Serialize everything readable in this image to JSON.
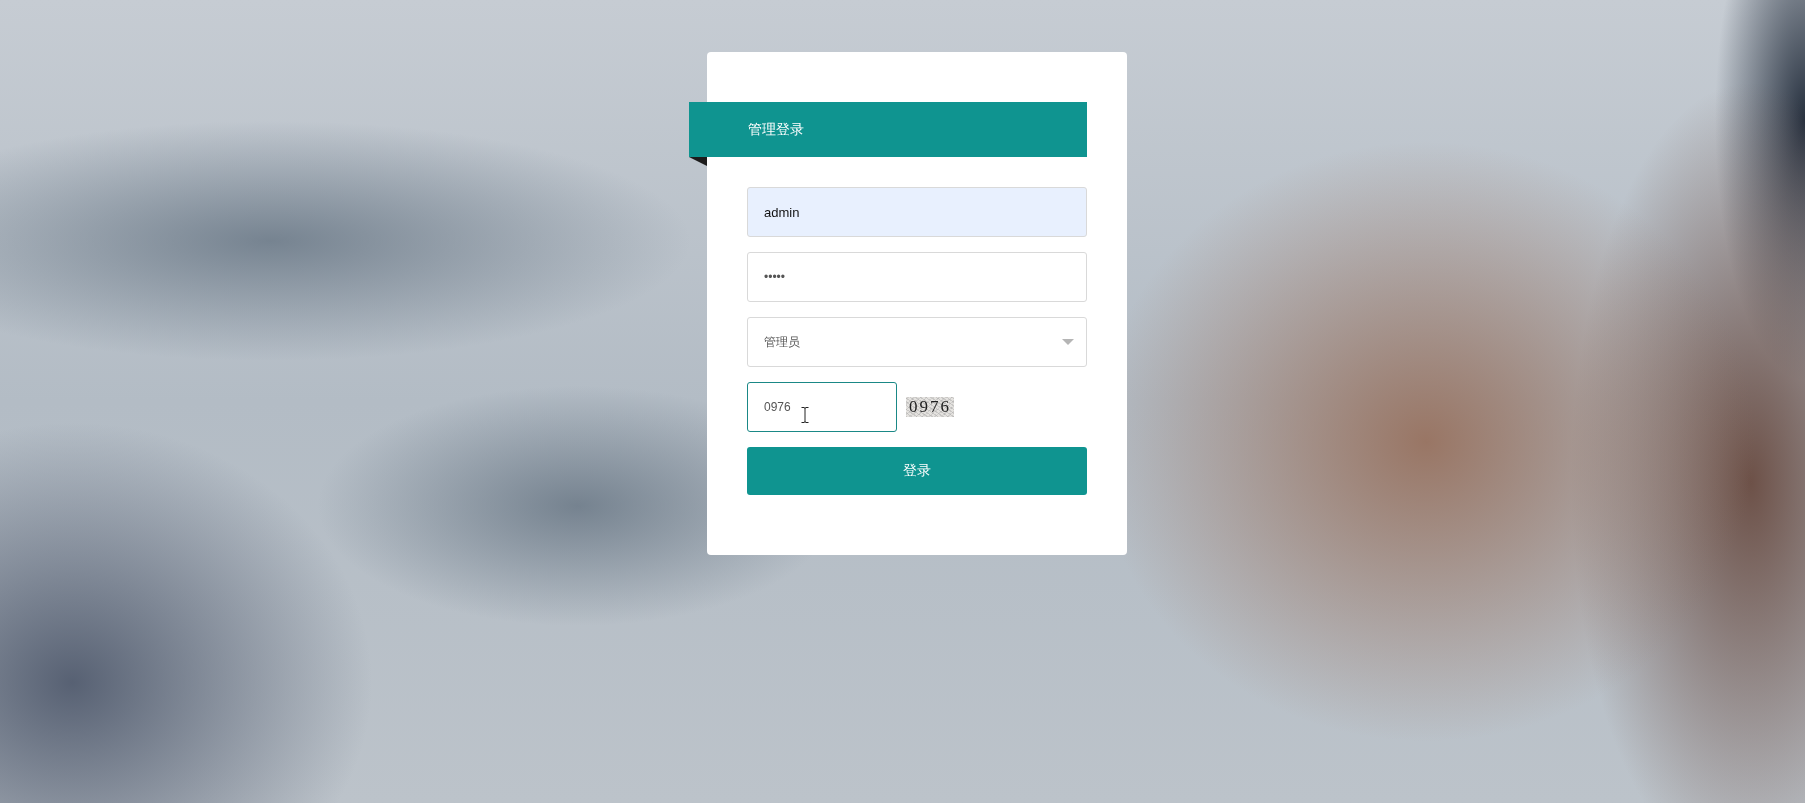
{
  "title": "管理登录",
  "fields": [
    {
      "kind": "text",
      "value": "admin",
      "autofilled": true,
      "focused": false
    },
    {
      "kind": "password",
      "value": "•••••",
      "autofilled": false,
      "focused": false
    },
    {
      "kind": "select",
      "value": "管理员",
      "autofilled": false,
      "focused": false
    },
    {
      "kind": "captcha",
      "value": "0976",
      "autofilled": false,
      "focused": true,
      "image_text": "0976"
    }
  ],
  "submit": "登录"
}
